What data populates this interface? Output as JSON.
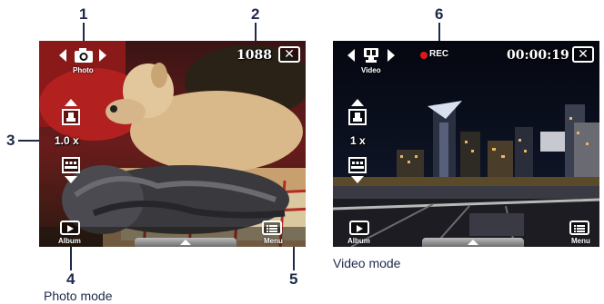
{
  "callouts": {
    "c1": "1",
    "c2": "2",
    "c3": "3",
    "c4": "4",
    "c5": "5",
    "c6": "6"
  },
  "captions": {
    "photo": "Photo mode",
    "video": "Video mode"
  },
  "photo_screen": {
    "mode_label": "Photo",
    "mode_icon": "camera-icon",
    "shot_counter": "1088",
    "zoom": "1.0 x",
    "left_softkey": "Album",
    "right_softkey": "Menu",
    "close": "✕"
  },
  "video_screen": {
    "mode_label": "Video",
    "mode_icon": "video-camera-icon",
    "rec_label": "REC",
    "timer": "00:00:19",
    "zoom": "1 x",
    "left_softkey": "Album",
    "right_softkey": "Menu",
    "close": "✕"
  },
  "colors": {
    "callout": "#1e2a4a",
    "rec": "#e01818",
    "overlay": "#ffffff"
  }
}
